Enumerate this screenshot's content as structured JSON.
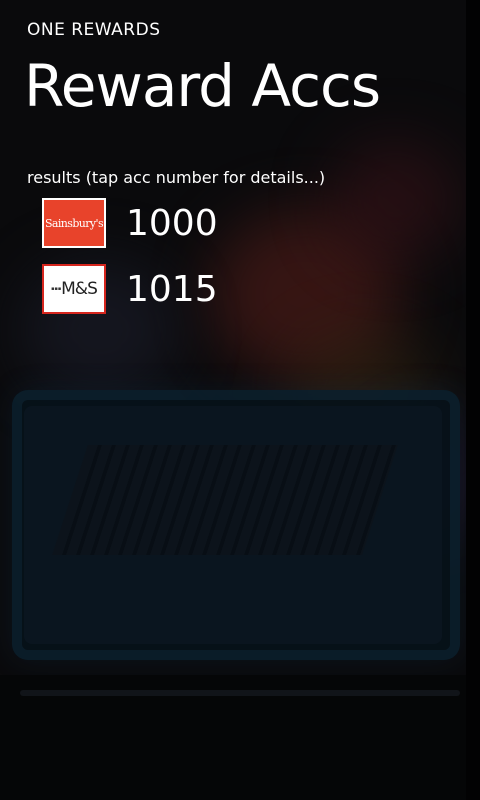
{
  "app": {
    "title": "ONE REWARDS",
    "page_title": "Reward Accs"
  },
  "results": {
    "label": "results (tap acc number for details...)"
  },
  "accounts": [
    {
      "logo_text": "Sainsbury's",
      "number": "1000"
    },
    {
      "logo_text": "M&S",
      "number": "1015"
    }
  ],
  "colors": {
    "sainsburys_logo": "#e8432b",
    "ms_logo_border": "#d6261e",
    "text": "#ffffff"
  }
}
